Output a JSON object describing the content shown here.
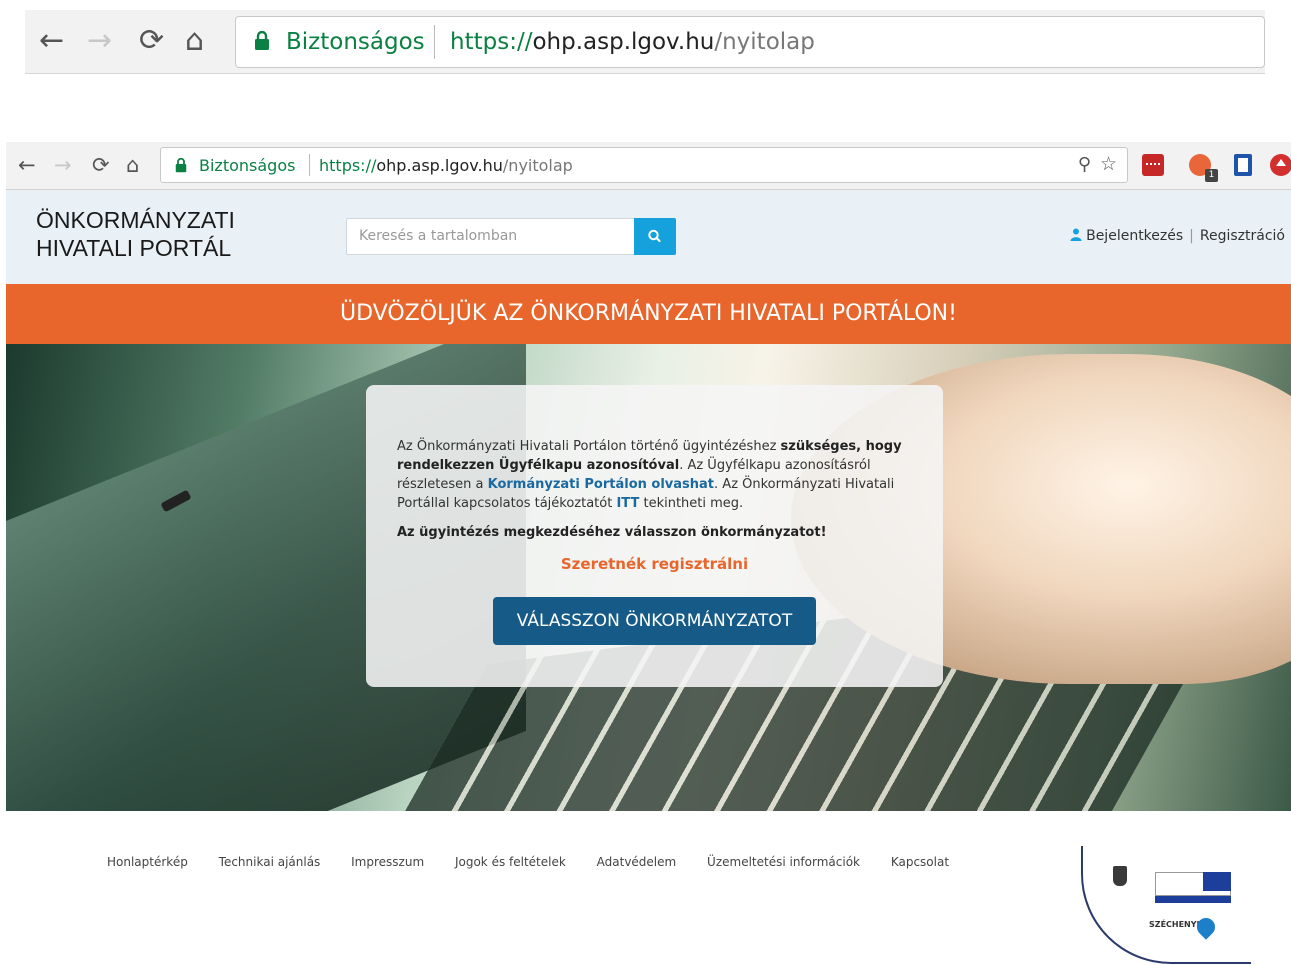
{
  "zoom_bar": {
    "secure_label": "Biztonságos",
    "url_proto": "https://",
    "url_host": "ohp.asp.lgov.hu",
    "url_path": "/nyitolap"
  },
  "browser": {
    "secure_label": "Biztonságos",
    "url_proto": "https://",
    "url_host": "ohp.asp.lgov.hu",
    "url_path": "/nyitolap",
    "extension_badge": "1",
    "icons": [
      "back-icon",
      "forward-icon",
      "reload-icon",
      "home-icon",
      "lock-icon",
      "zoom-icon",
      "star-icon"
    ]
  },
  "header": {
    "brand_line1": "ÖNKORMÁNYZATI",
    "brand_line2": "HIVATALI PORTÁL",
    "search_placeholder": "Keresés a tartalomban",
    "login_label": "Bejelentkezés",
    "register_label": "Regisztráció"
  },
  "banner": {
    "title": "ÜDVÖZÖLJÜK AZ ÖNKORMÁNYZATI HIVATALI PORTÁLON!"
  },
  "card": {
    "text_1": "Az Önkormányzati Hivatali Portálon történő ügyintézéshez ",
    "text_bold_1": "szükséges, hogy rendelkezzen Ügyfélkapu azonosítóval",
    "text_2": ". Az Ügyfélkapu azonosításról részletesen a ",
    "link_1": "Kormányzati Portálon olvashat",
    "text_3": ". Az Önkormányzati Hivatali Portállal kapcsolatos tájékoztatót ",
    "link_2": "ITT",
    "text_4": " tekintheti meg.",
    "prompt": "Az ügyintézés megkezdéséhez válasszon önkormányzatot!",
    "register_link": "Szeretnék regisztrálni",
    "button": "VÁLASSZON ÖNKORMÁNYZATOT"
  },
  "footer": {
    "links": [
      "Honlaptérkép",
      "Technikai ajánlás",
      "Impresszum",
      "Jogok és feltételek",
      "Adatvédelem",
      "Üzemeltetési információk",
      "Kapcsolat"
    ],
    "logo_text": "SZÉCHENYI"
  },
  "colors": {
    "accent_orange": "#e8652c",
    "button_blue": "#165b88",
    "search_blue": "#14a1dc",
    "secure_green": "#0b8043"
  }
}
